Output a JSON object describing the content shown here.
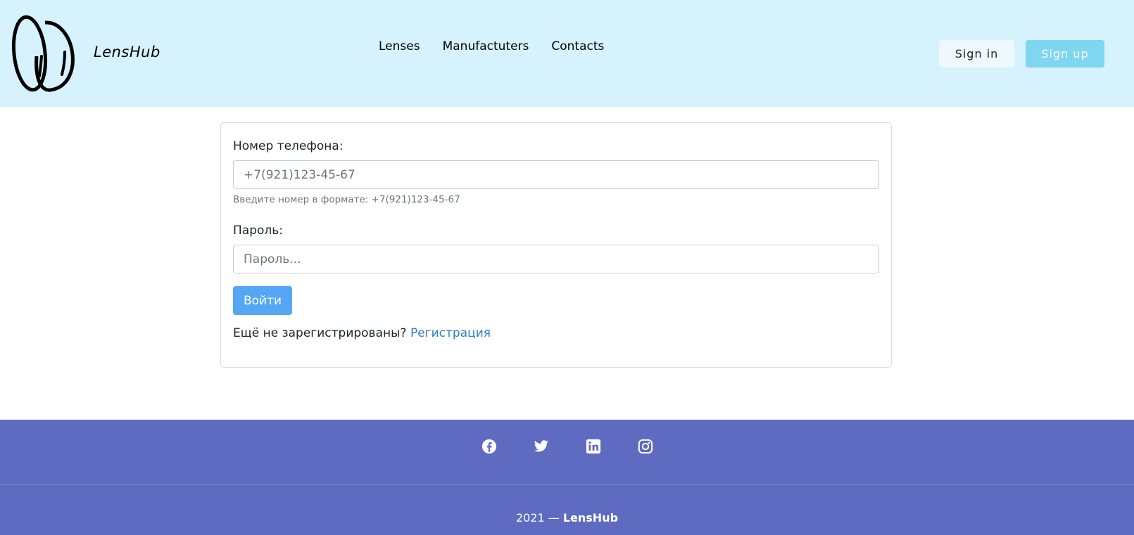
{
  "header": {
    "brand": "LensHub",
    "nav": [
      "Lenses",
      "Manufactuters",
      "Contacts"
    ],
    "sign_in": "Sign in",
    "sign_up": "Sign up"
  },
  "form": {
    "phone_label": "Номер телефона:",
    "phone_placeholder": "+7(921)123-45-67",
    "phone_hint": "Введите номер в формате: +7(921)123-45-67",
    "password_label": "Пароль:",
    "password_placeholder": "Пароль...",
    "submit": "Войти",
    "register_prompt": "Ещё не зарегистрированы?",
    "register_link": "Регистрация"
  },
  "footer": {
    "social_icons": [
      "facebook-icon",
      "twitter-icon",
      "linkedin-icon",
      "instagram-icon"
    ],
    "copyright_prefix": "2021 —",
    "copyright_brand": "LensHub"
  },
  "colors": {
    "header_bg": "#d5f2fd",
    "primary_button": "#55a6f5",
    "signup_button": "#7fd6f1",
    "footer_bg": "#5e6bc0",
    "link": "#2f7fc1"
  }
}
